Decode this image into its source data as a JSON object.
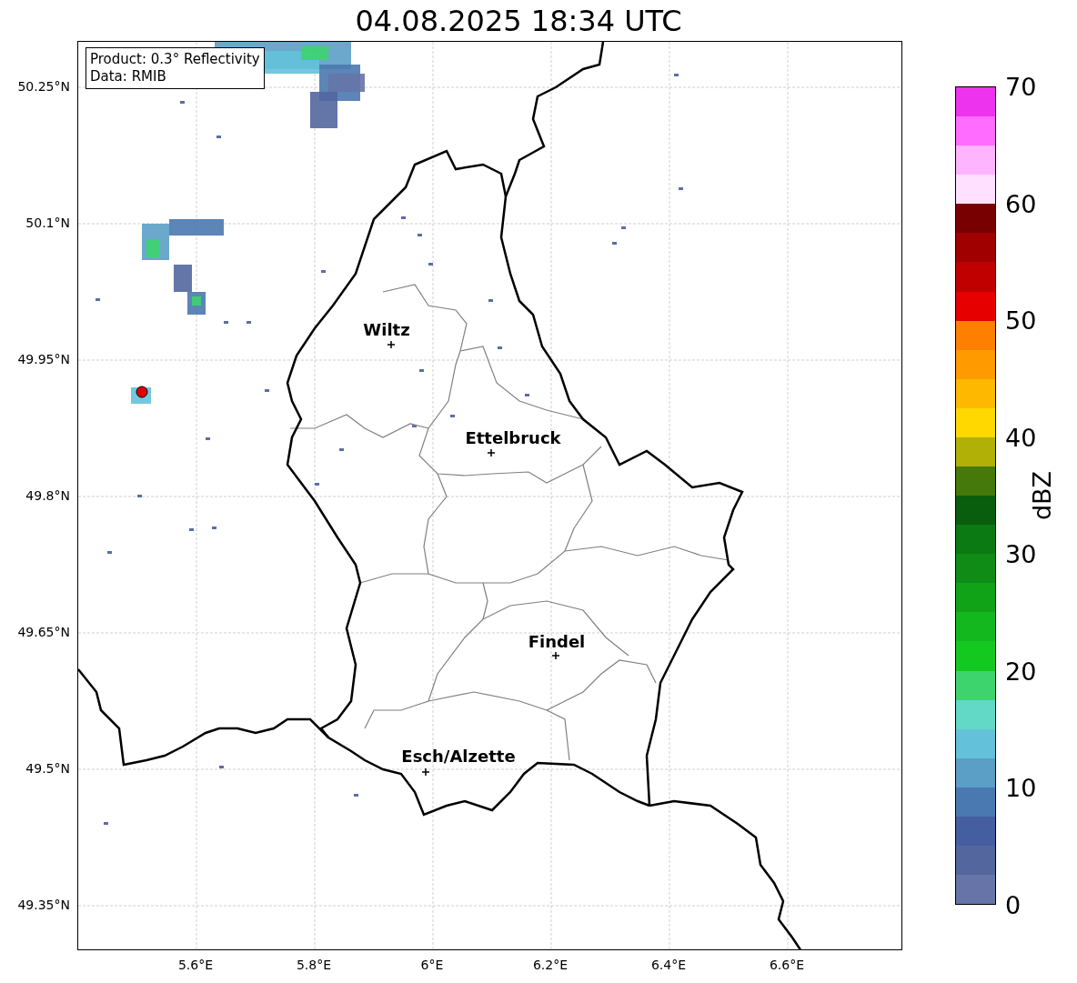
{
  "title": "04.08.2025 18:34 UTC",
  "info_box": [
    "Product: 0.3° Reflectivity",
    "Data: RMIB"
  ],
  "y_ticks": [
    "50.25°N",
    "50.1°N",
    "49.95°N",
    "49.8°N",
    "49.65°N",
    "49.5°N",
    "49.35°N"
  ],
  "x_ticks": [
    "5.6°E",
    "5.8°E",
    "6°E",
    "6.2°E",
    "6.4°E",
    "6.6°E"
  ],
  "cities": [
    {
      "name": "Wiltz"
    },
    {
      "name": "Ettelbruck"
    },
    {
      "name": "Findel"
    },
    {
      "name": "Esch/Alzette"
    }
  ],
  "colorbar": {
    "label": "dBZ",
    "ticks": [
      "70",
      "60",
      "50",
      "40",
      "30",
      "20",
      "10",
      "0"
    ],
    "bins": [
      {
        "color": "#ee33ee"
      },
      {
        "color": "#ff6cff"
      },
      {
        "color": "#ffb4ff"
      },
      {
        "color": "#ffe0ff"
      },
      {
        "color": "#780000"
      },
      {
        "color": "#a00000"
      },
      {
        "color": "#c00000"
      },
      {
        "color": "#e60000"
      },
      {
        "color": "#ff7f00"
      },
      {
        "color": "#ff9a00"
      },
      {
        "color": "#ffb800"
      },
      {
        "color": "#ffd800"
      },
      {
        "color": "#b0b006"
      },
      {
        "color": "#46780a"
      },
      {
        "color": "#085e0c"
      },
      {
        "color": "#0c7a12"
      },
      {
        "color": "#0e8c16"
      },
      {
        "color": "#10a318"
      },
      {
        "color": "#12b81e"
      },
      {
        "color": "#13c81e"
      },
      {
        "color": "#3dd46e"
      },
      {
        "color": "#62d8c6"
      },
      {
        "color": "#64c1da"
      },
      {
        "color": "#5b9ec6"
      },
      {
        "color": "#4a78b0"
      },
      {
        "color": "#445ea0"
      },
      {
        "color": "#53669e"
      },
      {
        "color": "#6674a8"
      }
    ]
  }
}
